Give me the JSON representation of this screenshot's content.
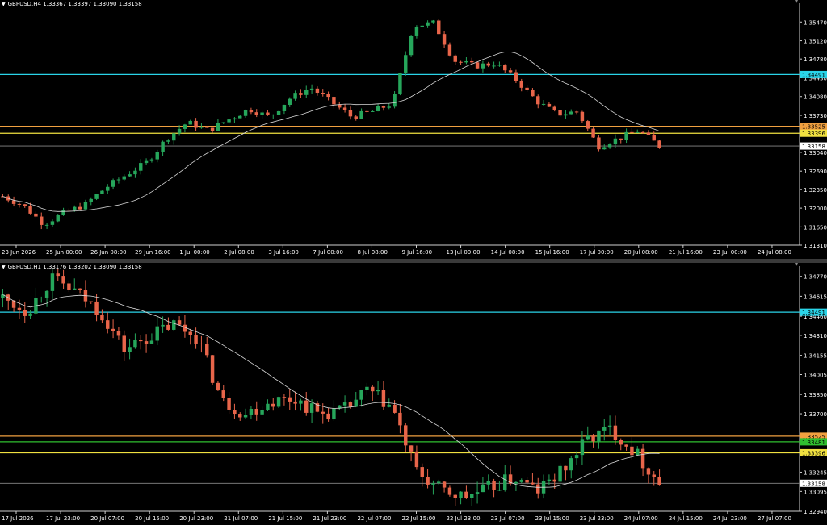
{
  "app": {
    "pane_separator": "drag-handle"
  },
  "colors": {
    "background": "#000000",
    "frame": "#d0d0d0",
    "bull": "#26a65b",
    "bear": "#e8654a",
    "ma": "#d8d8d8",
    "cyan": "#2ad4e8",
    "orange": "#f0a040",
    "yellow": "#f0e040",
    "green": "#30c030",
    "bid": "#888888",
    "label_text": "#000000",
    "bid_label_bg": "#ffffff"
  },
  "icons": {
    "menu": "triangle-down-icon"
  },
  "chart_data": [
    {
      "type": "candlestick",
      "symbol": "GBPUSD,H4",
      "title": "GBPUSD,H4  1.33367 1.33397 1.33090 1.33158",
      "ohlc_header": [
        "1.33367",
        "1.33397",
        "1.33090",
        "1.33158"
      ],
      "ylim": [
        1.3131,
        1.3582
      ],
      "y_ticks": [
        "1.35470",
        "1.35120",
        "1.34780",
        "1.34430",
        "1.34080",
        "1.33730",
        "1.33040",
        "1.32690",
        "1.32350",
        "1.32000",
        "1.31650",
        "1.31310"
      ],
      "x_ticks": [
        "23 Jun 2026",
        "25 Jun 00:00",
        "26 Jun 08:00",
        "29 Jun 16:00",
        "1 Jul 00:00",
        "2 Jul 08:00",
        "3 Jul 16:00",
        "7 Jul 00:00",
        "8 Jul 08:00",
        "9 Jul 16:00",
        "13 Jul 00:00",
        "14 Jul 08:00",
        "15 Jul 16:00",
        "17 Jul 00:00",
        "20 Jul 08:00",
        "21 Jul 16:00",
        "23 Jul 00:00",
        "24 Jul 08:00"
      ],
      "levels": [
        {
          "price": 1.34491,
          "label": "1.34491",
          "color": "cyan"
        },
        {
          "price": 1.33525,
          "label": "1.33525",
          "color": "orange"
        },
        {
          "price": 1.33396,
          "label": "1.33396",
          "color": "yellow"
        },
        {
          "price": 1.33158,
          "label": "1.33158",
          "color": "bid",
          "is_bid": true
        }
      ],
      "candles": [],
      "ma_period": 20
    },
    {
      "type": "candlestick",
      "symbol": "GBPUSD,H1",
      "title": "GBPUSD,H1  1.33176 1.33202 1.33090 1.33158",
      "ohlc_header": [
        "1.33176",
        "1.33202",
        "1.33090",
        "1.33158"
      ],
      "ylim": [
        1.3294,
        1.3485
      ],
      "y_ticks": [
        "1.34770",
        "1.34615",
        "1.34460",
        "1.34310",
        "1.34155",
        "1.34005",
        "1.33850",
        "1.33700",
        "1.33245",
        "1.33095",
        "1.32940"
      ],
      "x_ticks": [
        "17 Jul 2026",
        "17 Jul 23:00",
        "20 Jul 07:00",
        "20 Jul 15:00",
        "20 Jul 23:00",
        "21 Jul 07:00",
        "21 Jul 15:00",
        "21 Jul 23:00",
        "22 Jul 07:00",
        "22 Jul 15:00",
        "22 Jul 23:00",
        "23 Jul 07:00",
        "23 Jul 15:00",
        "23 Jul 23:00",
        "24 Jul 07:00",
        "24 Jul 15:00",
        "24 Jul 23:00",
        "27 Jul 07:00"
      ],
      "levels": [
        {
          "price": 1.34491,
          "label": "1.34491",
          "color": "cyan"
        },
        {
          "price": 1.33525,
          "label": "1.33525",
          "color": "orange"
        },
        {
          "price": 1.33481,
          "label": "1.33481",
          "color": "green"
        },
        {
          "price": 1.33396,
          "label": "1.33396",
          "color": "yellow"
        },
        {
          "price": 1.33158,
          "label": "1.33158",
          "color": "bid",
          "is_bid": true
        }
      ],
      "candles": [],
      "ma_period": 20
    }
  ]
}
